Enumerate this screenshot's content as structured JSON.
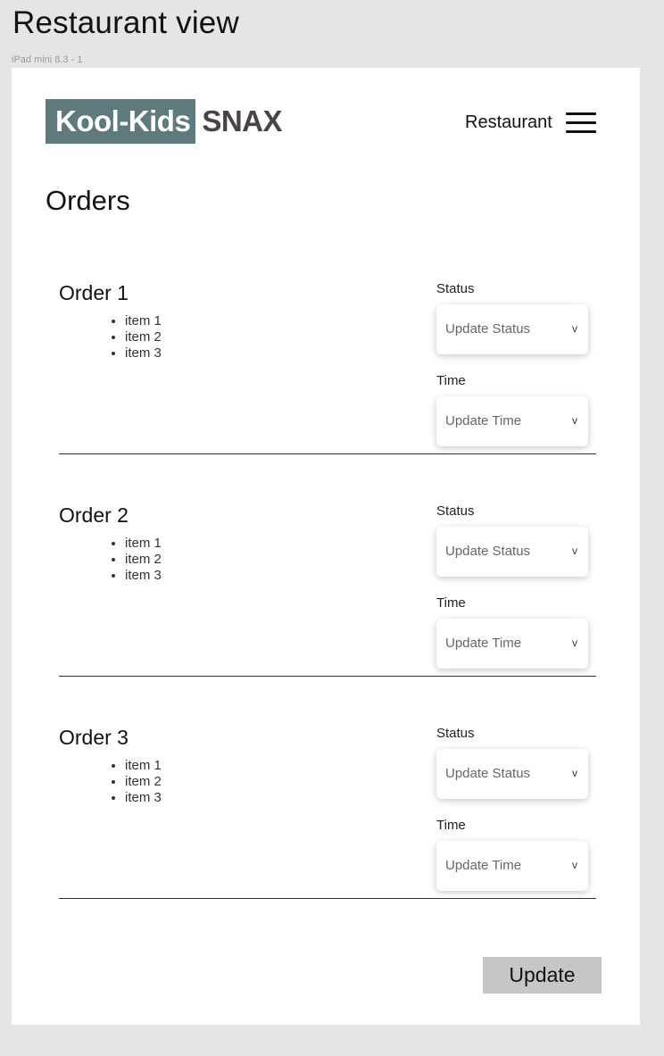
{
  "canvas": {
    "title": "Restaurant view",
    "frame_label": "iPad mini 8.3 - 1"
  },
  "header": {
    "logo_primary": "Kool-Kids",
    "logo_secondary": "SNAX",
    "nav_label": "Restaurant",
    "menu_icon": "hamburger-menu-icon"
  },
  "page": {
    "title": "Orders"
  },
  "orders": [
    {
      "title": "Order 1",
      "items": [
        "item 1",
        "item 2",
        "item 3"
      ],
      "status_label": "Status",
      "status_placeholder": "Update Status",
      "time_label": "Time",
      "time_placeholder": "Update Time",
      "chevron": "v"
    },
    {
      "title": "Order 2",
      "items": [
        "item 1",
        "item 2",
        "item 3"
      ],
      "status_label": "Status",
      "status_placeholder": "Update Status",
      "time_label": "Time",
      "time_placeholder": "Update Time",
      "chevron": "v"
    },
    {
      "title": "Order 3",
      "items": [
        "item 1",
        "item 2",
        "item 3"
      ],
      "status_label": "Status",
      "status_placeholder": "Update Status",
      "time_label": "Time",
      "time_placeholder": "Update Time",
      "chevron": "v"
    }
  ],
  "actions": {
    "update_label": "Update"
  },
  "colors": {
    "logo_bg": "#5f7a7d",
    "logo_text": "#4a4344",
    "button_bg": "#c6c6c6",
    "canvas_bg": "#e5e5e5"
  }
}
